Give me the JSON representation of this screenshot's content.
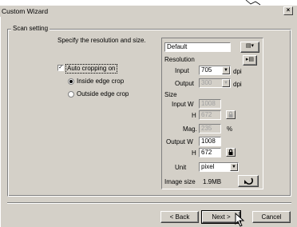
{
  "window": {
    "title": "Custom Wizard",
    "close_label": "×"
  },
  "group": {
    "label": "Scan setting"
  },
  "instruction": "Specify the resolution and size.",
  "auto_crop": {
    "label": "Auto cropping on",
    "checked": true
  },
  "radios": [
    {
      "label": "Inside edge crop",
      "selected": true
    },
    {
      "label": "Outside edge crop",
      "selected": false
    }
  ],
  "panel": {
    "preset": "Default",
    "resolution_label": "Resolution",
    "input_label": "Input",
    "input_value": "705",
    "input_unit": "dpi",
    "output_label": "Output",
    "output_value": "300",
    "output_unit": "dpi",
    "size_label": "Size",
    "input_w_label": "Input W",
    "input_w_value": "1008",
    "input_h_label": "H",
    "input_h_value": "672",
    "mag_label": "Mag.",
    "mag_value": "235",
    "mag_unit": "%",
    "output_w_label": "Output W",
    "output_w_value": "1008",
    "output_h_label": "H",
    "output_h_value": "672",
    "unit_label": "Unit",
    "unit_value": "pixel",
    "image_size_label": "Image size",
    "image_size_value": "1.9MB"
  },
  "buttons": {
    "back": "< Back",
    "next": "Next >",
    "cancel": "Cancel"
  }
}
